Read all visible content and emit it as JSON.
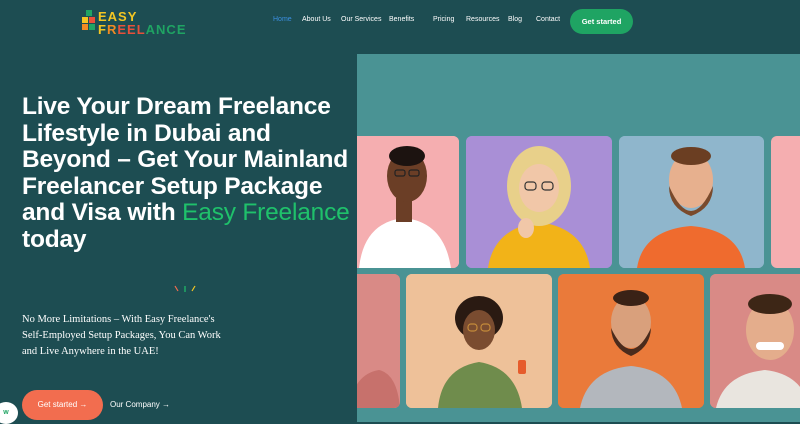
{
  "nav": {
    "logo_top": "EASY",
    "logo_bottom": [
      "F",
      "R",
      "E",
      "E",
      "L",
      "A",
      "N",
      "C",
      "E"
    ],
    "items": [
      "Home",
      "About Us",
      "Our Services",
      "Benefits",
      "Pricing",
      "Resources",
      "Blog",
      "Contact"
    ],
    "cta": "Get started"
  },
  "hero": {
    "title_main": "Live Your Dream Freelance Lifestyle in Dubai and Beyond – Get Your Mainland Freelancer Setup Package and Visa with ",
    "title_brand": "Easy Freelance",
    "title_end": " today",
    "subtitle": "No More Limitations – With Easy Freelance's Self-Employed Setup Packages, You Can Work and Live Anywhere in the UAE!",
    "btn_start": "Get started",
    "btn_company": "Our Company",
    "arrow": "→"
  },
  "widget": {
    "label": "w"
  },
  "colors": {
    "bg": "#1d4d52",
    "accent_green": "#1fa463",
    "accent_orange": "#f26d4f",
    "link_active": "#3b8fe0",
    "gallery_bg": "#4a9394"
  },
  "icons": [
    "logo-blocks-icon",
    "arrow-right-icon",
    "whatsapp-icon"
  ]
}
